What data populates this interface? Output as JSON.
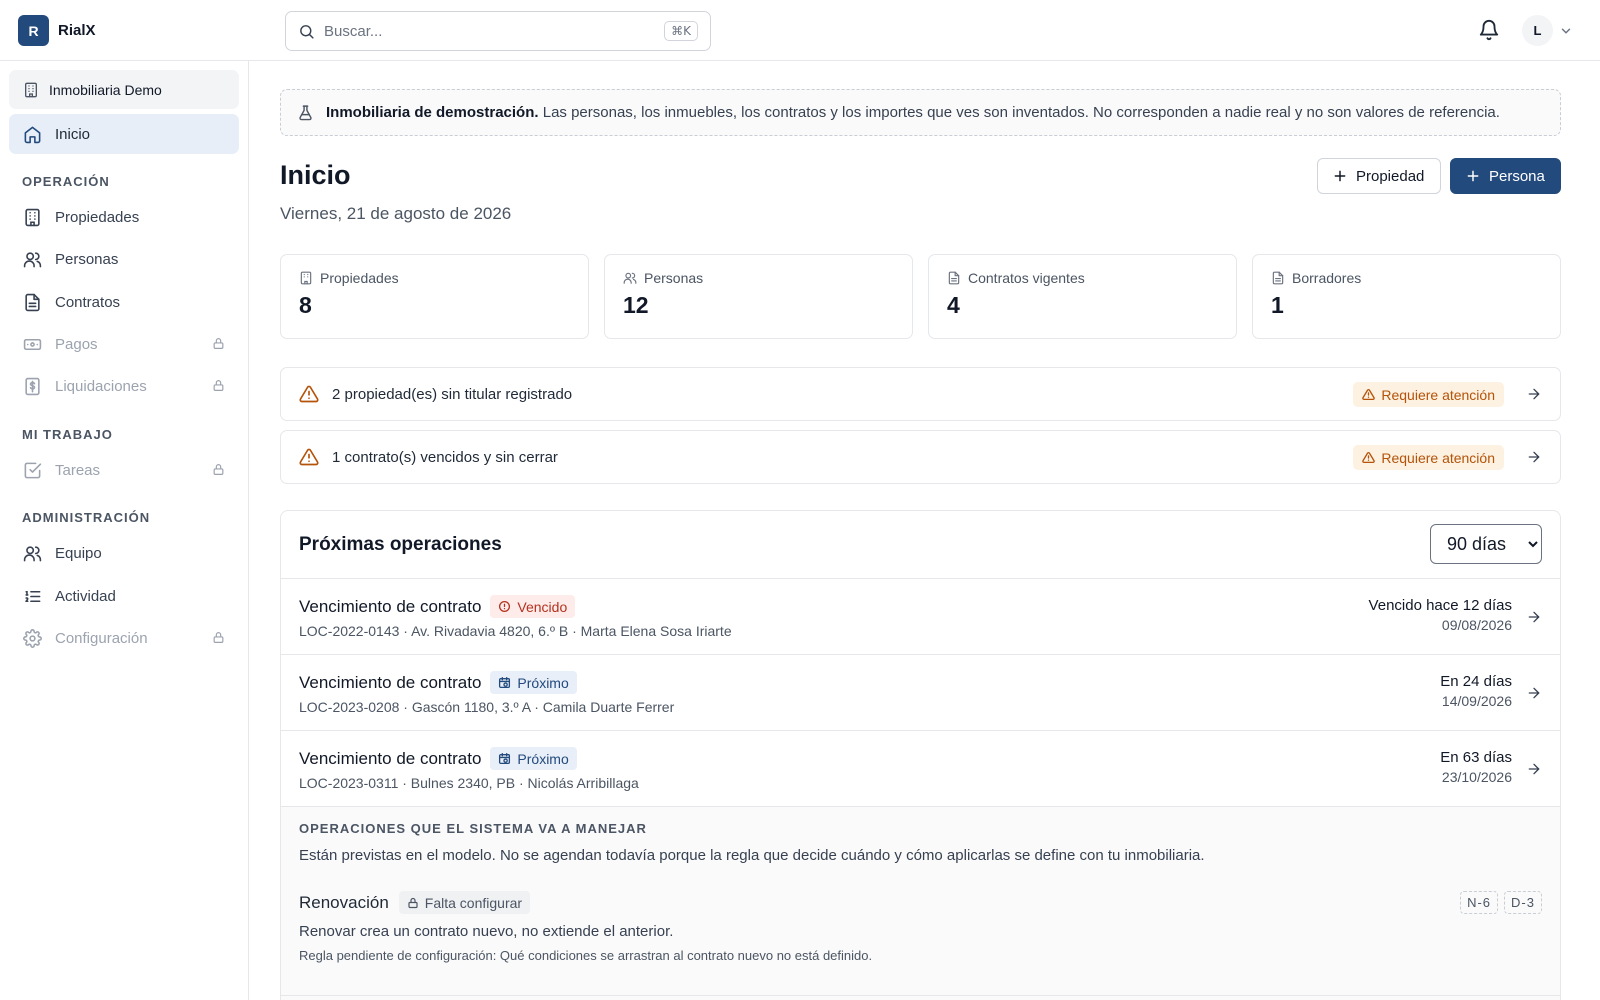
{
  "app": {
    "logo_letter": "R",
    "name": "RialX"
  },
  "search": {
    "placeholder": "Buscar...",
    "shortcut": "⌘K"
  },
  "user": {
    "initial": "L"
  },
  "sidebar": {
    "org_name": "Inmobiliaria Demo",
    "home": "Inicio",
    "sections": {
      "operacion": "OPERACIÓN",
      "mi_trabajo": "MI TRABAJO",
      "administracion": "ADMINISTRACIÓN"
    },
    "items": {
      "propiedades": "Propiedades",
      "personas": "Personas",
      "contratos": "Contratos",
      "pagos": "Pagos",
      "liquidaciones": "Liquidaciones",
      "tareas": "Tareas",
      "equipo": "Equipo",
      "actividad": "Actividad",
      "configuracion": "Configuración"
    }
  },
  "banner": {
    "bold": "Inmobiliaria de demostración.",
    "text": "Las personas, los inmuebles, los contratos y los importes que ves son inventados. No corresponden a nadie real y no son valores de referencia."
  },
  "page": {
    "title": "Inicio",
    "date": "Viernes, 21 de agosto de 2026",
    "btn_property": "Propiedad",
    "btn_person": "Persona"
  },
  "stats": [
    {
      "label": "Propiedades",
      "value": "8"
    },
    {
      "label": "Personas",
      "value": "12"
    },
    {
      "label": "Contratos vigentes",
      "value": "4"
    },
    {
      "label": "Borradores",
      "value": "1"
    }
  ],
  "alerts": [
    {
      "text": "2 propiedad(es) sin titular registrado",
      "badge": "Requiere atención"
    },
    {
      "text": "1 contrato(s) vencidos y sin cerrar",
      "badge": "Requiere atención"
    }
  ],
  "operations": {
    "title": "Próximas operaciones",
    "range_selected": "90 días",
    "rows": [
      {
        "title": "Vencimiento de contrato",
        "chip": "Vencido",
        "sub": "LOC-2022-0143 · Av. Rivadavia 4820, 6.º B · Marta Elena Sosa Iriarte",
        "when": "Vencido hace 12 días",
        "date": "09/08/2026"
      },
      {
        "title": "Vencimiento de contrato",
        "chip": "Próximo",
        "sub": "LOC-2023-0208 · Gascón 1180, 3.º A · Camila Duarte Ferrer",
        "when": "En 24 días",
        "date": "14/09/2026"
      },
      {
        "title": "Vencimiento de contrato",
        "chip": "Próximo",
        "sub": "LOC-2023-0311 · Bulnes 2340, PB · Nicolás Arribillaga",
        "when": "En 63 días",
        "date": "23/10/2026"
      }
    ],
    "future": {
      "heading": "OPERACIONES QUE EL SISTEMA VA A MANEJAR",
      "desc": "Están previstas en el modelo. No se agendan todavía porque la regla que decide cuándo y cómo aplicarlas se define con tu inmobiliaria.",
      "item": {
        "title": "Renovación",
        "chip": "Falta configurar",
        "desc": "Renovar crea un contrato nuevo, no extiende el anterior.",
        "note": "Regla pendiente de configuración: Qué condiciones se arrastran al contrato nuevo no está definido.",
        "codes": [
          "N-6",
          "D-3"
        ]
      }
    }
  },
  "colors": {
    "primary": "#234a7d",
    "warning": "#b45309",
    "danger": "#b4321f",
    "active_bg": "#e7eef8"
  }
}
